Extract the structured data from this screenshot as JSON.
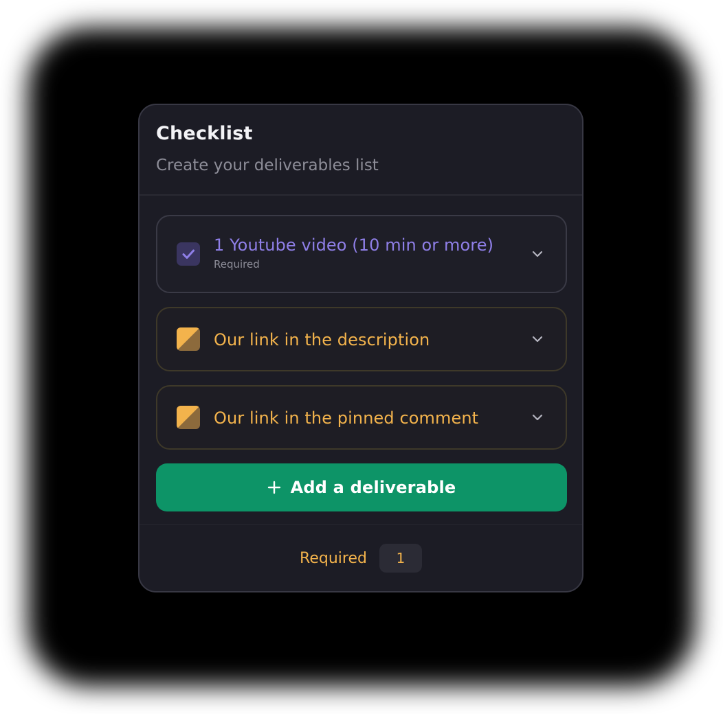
{
  "checklist": {
    "title": "Checklist",
    "subtitle": "Create your deliverables list",
    "items": [
      {
        "label": "1 Youtube video (10 min or more)",
        "sublabel": "Required",
        "state": "checked",
        "color": "#8f7fe8"
      },
      {
        "label": "Our link in the description",
        "state": "pending",
        "color": "#f3b34c"
      },
      {
        "label": "Our link in the pinned comment",
        "state": "pending",
        "color": "#f3b34c"
      }
    ],
    "add_button": {
      "icon": "plus-icon",
      "label": "Add a deliverable",
      "color": "#0d9467"
    },
    "footer": {
      "label": "Required",
      "count": "1"
    }
  }
}
